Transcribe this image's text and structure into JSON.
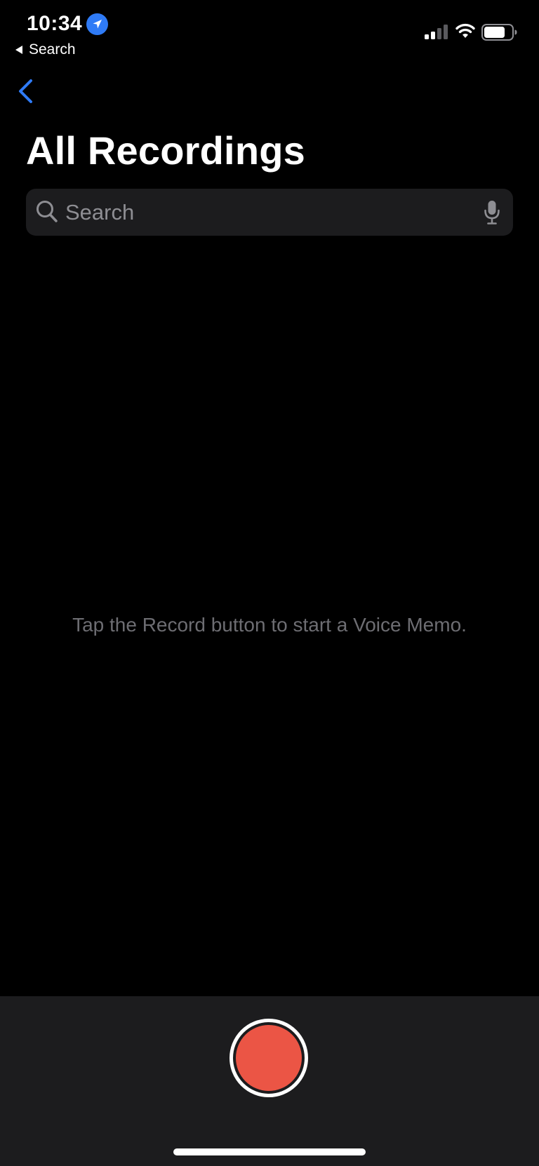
{
  "status_bar": {
    "time": "10:34",
    "back_app_label": "Search",
    "location_icon": "location-arrow-icon",
    "signal_icon": "cellular-signal-icon",
    "wifi_icon": "wifi-icon",
    "battery_icon": "battery-icon"
  },
  "nav": {
    "back_icon": "chevron-left-icon",
    "title": "All Recordings"
  },
  "search": {
    "placeholder": "Search",
    "value": "",
    "search_icon": "magnifying-glass-icon",
    "mic_icon": "microphone-icon"
  },
  "empty_state": {
    "message": "Tap the Record button to start a Voice Memo."
  },
  "record": {
    "icon": "record-icon"
  },
  "colors": {
    "accent": "#2f7bf6",
    "record": "#eb5545",
    "background": "#000000",
    "bar": "#1c1c1e"
  }
}
